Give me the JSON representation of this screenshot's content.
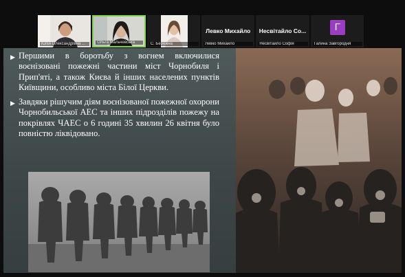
{
  "participants": [
    {
      "name": "Юлія Олександрівна ...",
      "type": "video"
    },
    {
      "name": "Ольга Мальчевська",
      "type": "video",
      "active": true
    },
    {
      "name": "С. Бережна",
      "type": "video"
    },
    {
      "name": "Левко Михайло",
      "display": "Левко Михайло",
      "type": "name"
    },
    {
      "name": "Несвітайло Софія",
      "display": "Несвітайло Со...",
      "type": "name"
    },
    {
      "name": "Галина Завгородня",
      "initial": "Г",
      "type": "avatar"
    }
  ],
  "slide": {
    "bullets": [
      "Першими в боротьбу з вогнем включилися воєнізовані пожежні частини міст Чорнобиля і Прип'яті, а також Києва й інших населених пунктів Київщини, особливо міста Білої Церкви.",
      "Завдяки рішучим діям воєнізованої пожежної охорони Чорнобильської АЕС та інших підрозділів пожежу на покрівлях ЧАЕС о 6 годині 35 хвилин 26 квітня було повністю ліквідовано."
    ]
  },
  "colors": {
    "active_border": "#7fd24a",
    "avatar_bg": "#9b3cc4",
    "slide_bg": "#4a5455"
  }
}
